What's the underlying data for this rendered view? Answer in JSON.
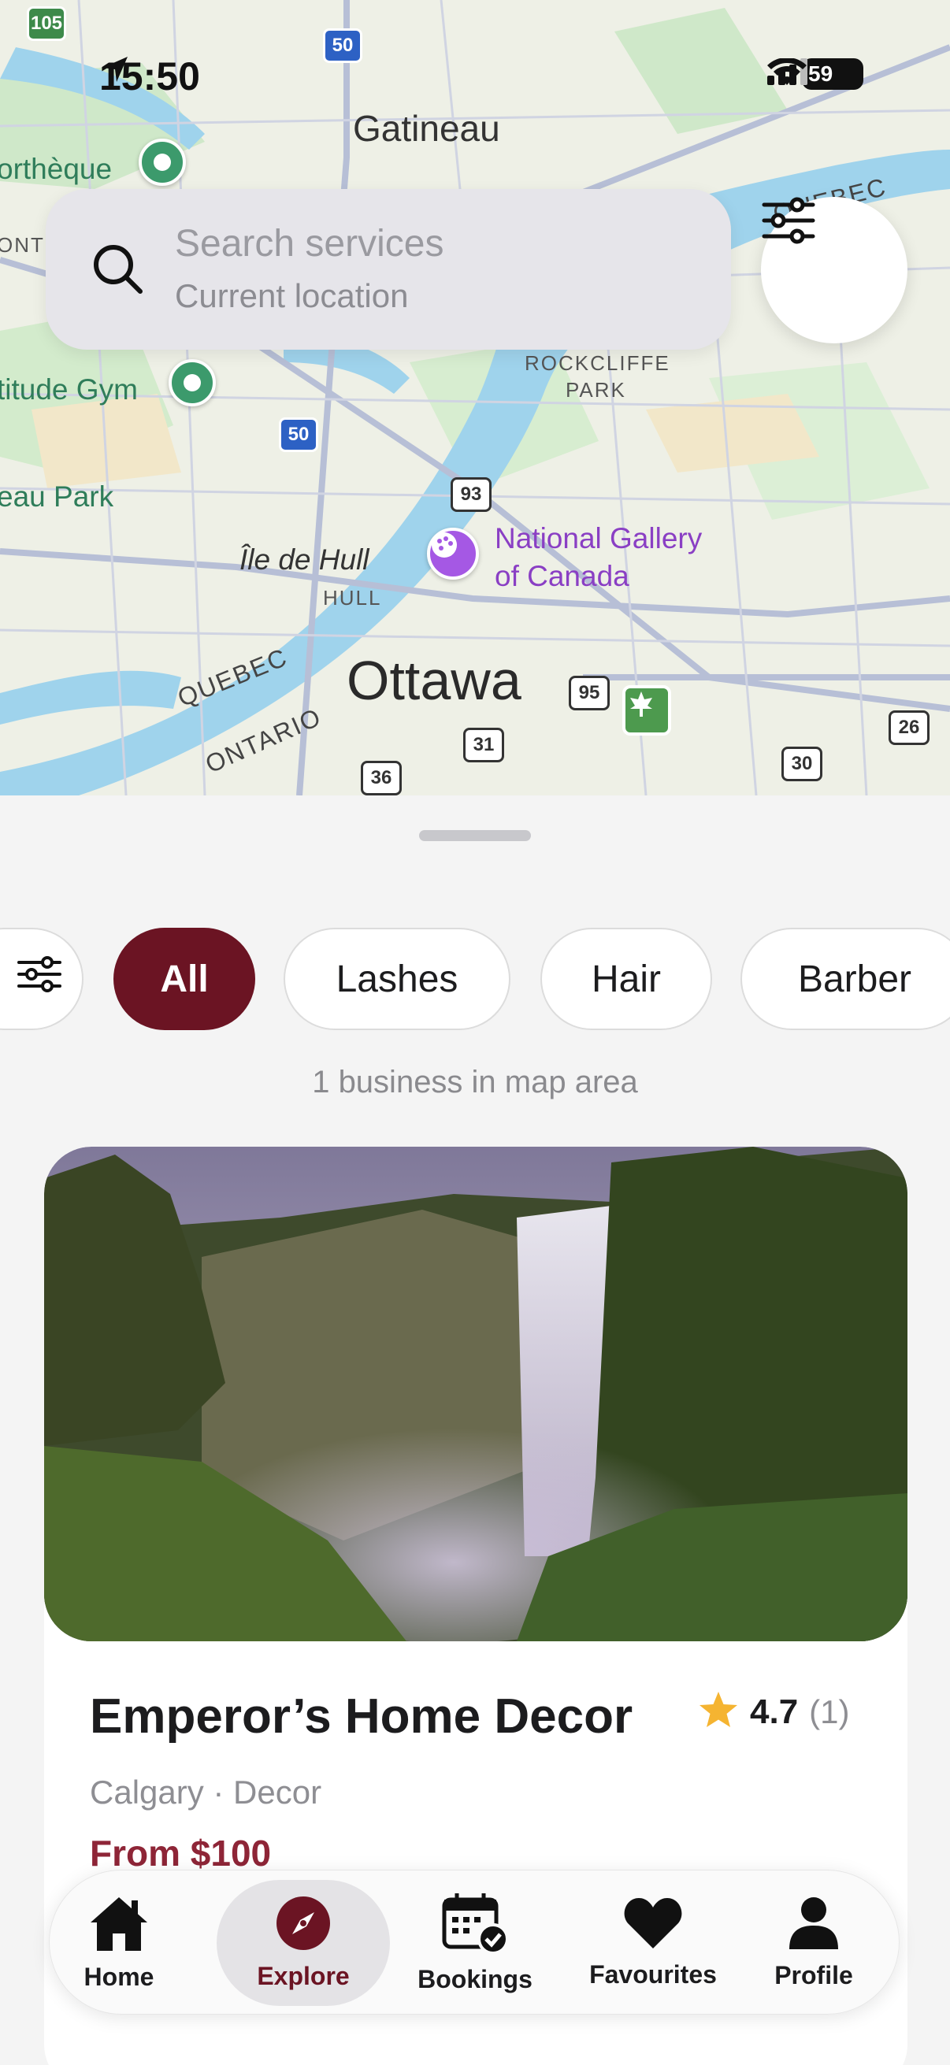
{
  "status_bar": {
    "time": "15:50",
    "battery": "59"
  },
  "map": {
    "labels": {
      "gatineau": "Gatineau",
      "ottawa": "Ottawa",
      "bibliotheque": "orthèque",
      "altitude_gym": "titude Gym",
      "park": "eau Park",
      "ile_de_hull": "Île de Hull",
      "hull": "HULL",
      "rockcliffe": "ROCKCLIFFE",
      "park_small": "PARK",
      "quebec": "QUEBEC",
      "ontario": "ONTARIO",
      "national_gallery_1": "National Gallery",
      "national_gallery_2": "of Canada",
      "ont": "ONT",
      "quebec_top": "QUEBEC"
    },
    "routes": {
      "r105": "105",
      "r50a": "50",
      "r50b": "50",
      "r93": "93",
      "r95": "95",
      "r31": "31",
      "r36": "36",
      "r30": "30",
      "r26": "26"
    }
  },
  "search": {
    "placeholder": "Search services",
    "subtitle": "Current location"
  },
  "filters": {
    "chips": [
      "All",
      "Lashes",
      "Hair",
      "Barber"
    ],
    "active": "All"
  },
  "results": {
    "count_text": "1 business in map area"
  },
  "business": {
    "name": "Emperor’s Home Decor",
    "rating": "4.7",
    "review_count": "(1)",
    "subtitle": "Calgary · Decor",
    "price": "From $100"
  },
  "tabbar": {
    "tabs": [
      "Home",
      "Explore",
      "Bookings",
      "Favourites",
      "Profile"
    ],
    "active": "Explore"
  },
  "colors": {
    "accent": "#6b1423",
    "price": "#8e2537",
    "star": "#f5b431",
    "poi_green": "#3c9a6c",
    "poi_purple": "#a558e4"
  }
}
